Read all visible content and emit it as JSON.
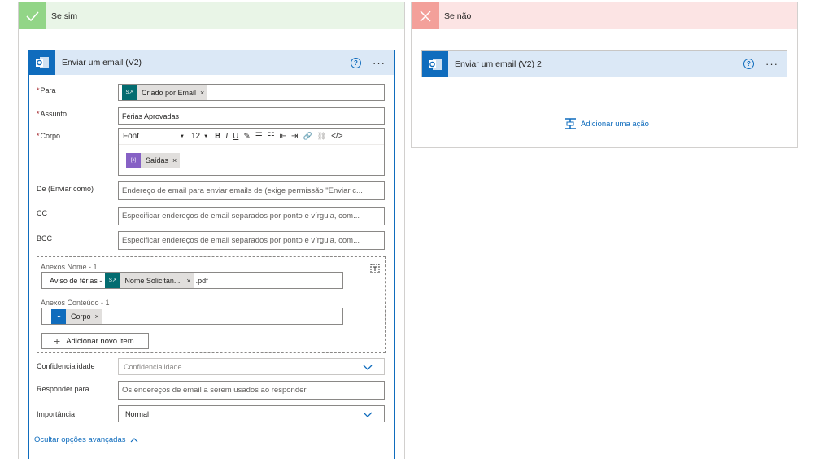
{
  "yes_branch": {
    "title": "Se sim",
    "action": {
      "title": "Enviar um email (V2)",
      "help": "?",
      "more": "···",
      "fields": {
        "to": {
          "label": "Para",
          "token": "Criado por Email",
          "token_remove": "×"
        },
        "subject": {
          "label": "Assunto",
          "value": "Férias Aprovadas"
        },
        "body": {
          "label": "Corpo",
          "font": "Font",
          "size": "12",
          "toolbar": [
            "B",
            "I",
            "U",
            "✎",
            "☰",
            "☷",
            "⇤",
            "⇥",
            "🔗",
            "⛓",
            "</>"
          ],
          "token": "Saídas",
          "token_remove": "×"
        },
        "from": {
          "label": "De (Enviar como)",
          "placeholder": "Endereço de email para enviar emails de (exige permissão \"Enviar c..."
        },
        "cc": {
          "label": "CC",
          "placeholder": "Especificar endereços de email separados por ponto e vírgula, com..."
        },
        "bcc": {
          "label": "BCC",
          "placeholder": "Especificar endereços de email separados por ponto e vírgula, com..."
        },
        "attachments": {
          "name_label": "Anexos Nome - 1",
          "name_prefix": "Aviso de férias -",
          "name_token": "Nome Solicitan...",
          "name_token_remove": "×",
          "name_suffix": ".pdf",
          "content_label": "Anexos Conteúdo - 1",
          "content_token": "Corpo",
          "content_token_remove": "×",
          "add_item": "Adicionar novo item"
        },
        "sensitivity": {
          "label": "Confidencialidade",
          "placeholder": "Confidencialidade"
        },
        "reply_to": {
          "label": "Responder para",
          "placeholder": "Os endereços de email a serem usados ao responder"
        },
        "importance": {
          "label": "Importância",
          "value": "Normal"
        }
      },
      "hide_advanced": "Ocultar opções avançadas"
    }
  },
  "no_branch": {
    "title": "Se não",
    "action": {
      "title": "Enviar um email (V2) 2",
      "help": "?",
      "more": "···"
    },
    "add_action": "Adicionar uma ação"
  },
  "colors": {
    "accent": "#0f6cbd",
    "yes_header": "#e9f5e7",
    "yes_icon": "#92d587",
    "no_header": "#fce4e4",
    "no_icon": "#f3a09a",
    "sharepoint": "#036c70",
    "variable": "#8661c5"
  },
  "icons": {
    "outlook": "outlook-icon",
    "sharepoint": "sharepoint-icon",
    "variable": "variable-icon",
    "onedrive": "cloud-icon"
  }
}
